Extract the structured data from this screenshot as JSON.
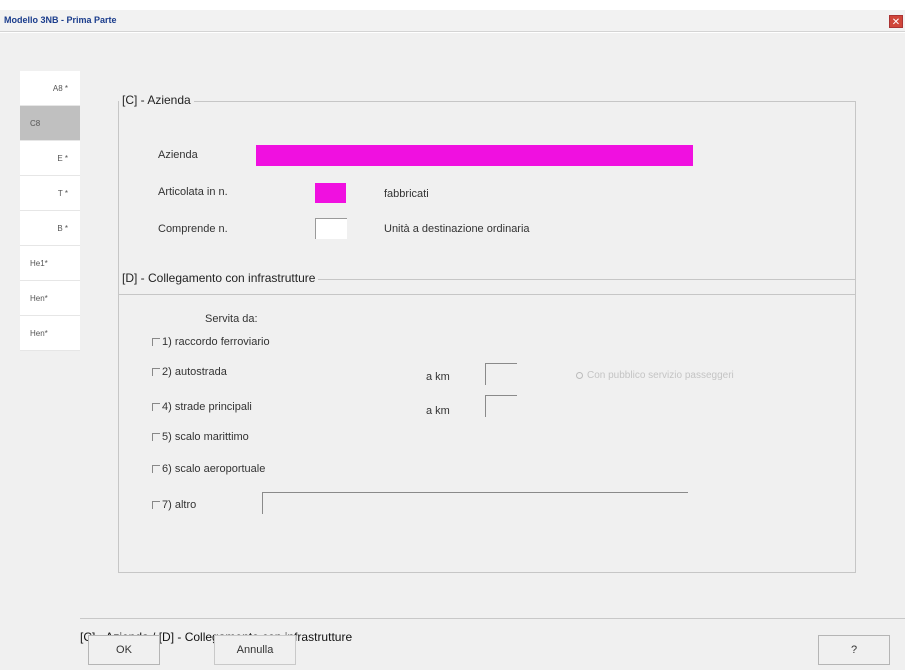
{
  "window": {
    "title": "Modello 3NB - Prima Parte",
    "close_glyph": "✕"
  },
  "tabs": [
    {
      "label": "A8 *",
      "active": false
    },
    {
      "label": "C8",
      "active": true
    },
    {
      "label": "E *",
      "active": false
    },
    {
      "label": "T *",
      "active": false
    },
    {
      "label": "B *",
      "active": false
    },
    {
      "label": "He1*",
      "active": false
    },
    {
      "label": "Hen*",
      "active": false
    },
    {
      "label": "Hen*",
      "active": false
    }
  ],
  "section_c": {
    "title": "[C] - Azienda",
    "azienda_label": "Azienda",
    "articolata_label": "Articolata in n.",
    "fabbricati_label": "fabbricati",
    "comprende_label": "Comprende n.",
    "unita_label": "Unità a destinazione ordinaria"
  },
  "section_d": {
    "title": "[D] - Collegamento con infrastrutture",
    "servita_label": "Servita da:",
    "options": [
      "1) raccordo ferroviario",
      "2) autostrada",
      "4) strade principali",
      "5) scalo marittimo",
      "6) scalo aeroportuale",
      "7) altro"
    ],
    "a_km_1": "a km",
    "a_km_2": "a km",
    "radio_disabled": "Con pubblico servizio passeggeri"
  },
  "footer": {
    "title": "[C] - Azienda / [D] - Collegamento con infrastrutture",
    "ok_label": "OK",
    "annulla_label": "Annulla",
    "help_label": "?"
  },
  "colors": {
    "pink_field": "#f010e0",
    "active_tab": "#c0c0c0",
    "dialog_bg": "#f0f0f0"
  }
}
